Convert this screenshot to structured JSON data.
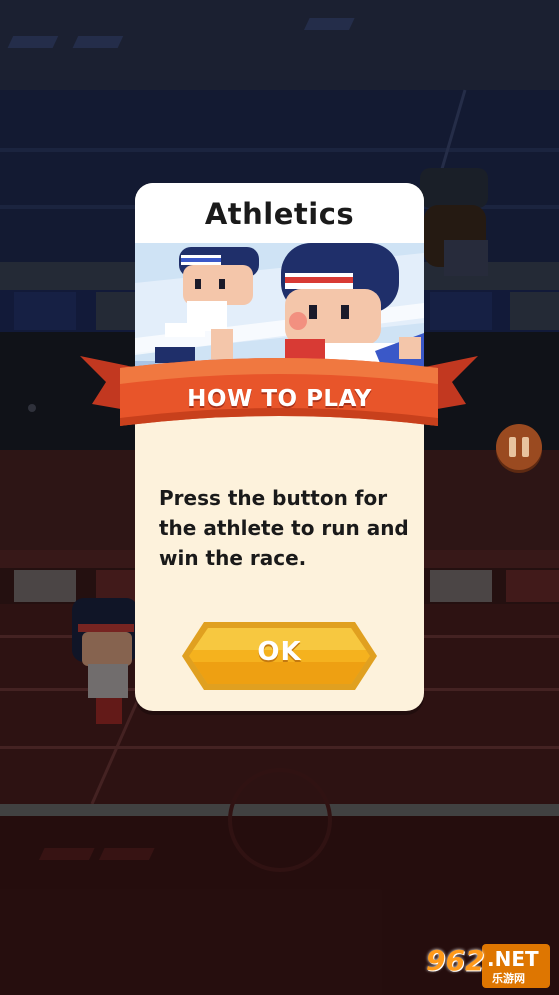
{
  "dialog": {
    "title": "Athletics",
    "banner": "HOW TO PLAY",
    "instructions": "Press the button for the athlete to run and win the race.",
    "ok_label": "OK"
  },
  "watermark": {
    "number": "962",
    "suffix": ".NET",
    "subtitle": "乐游网"
  },
  "colors": {
    "banner": "#e8552a",
    "ok_button": "#f5b21e",
    "dialog_bg": "#fdf2dc",
    "pause_button": "#9a4a20"
  }
}
